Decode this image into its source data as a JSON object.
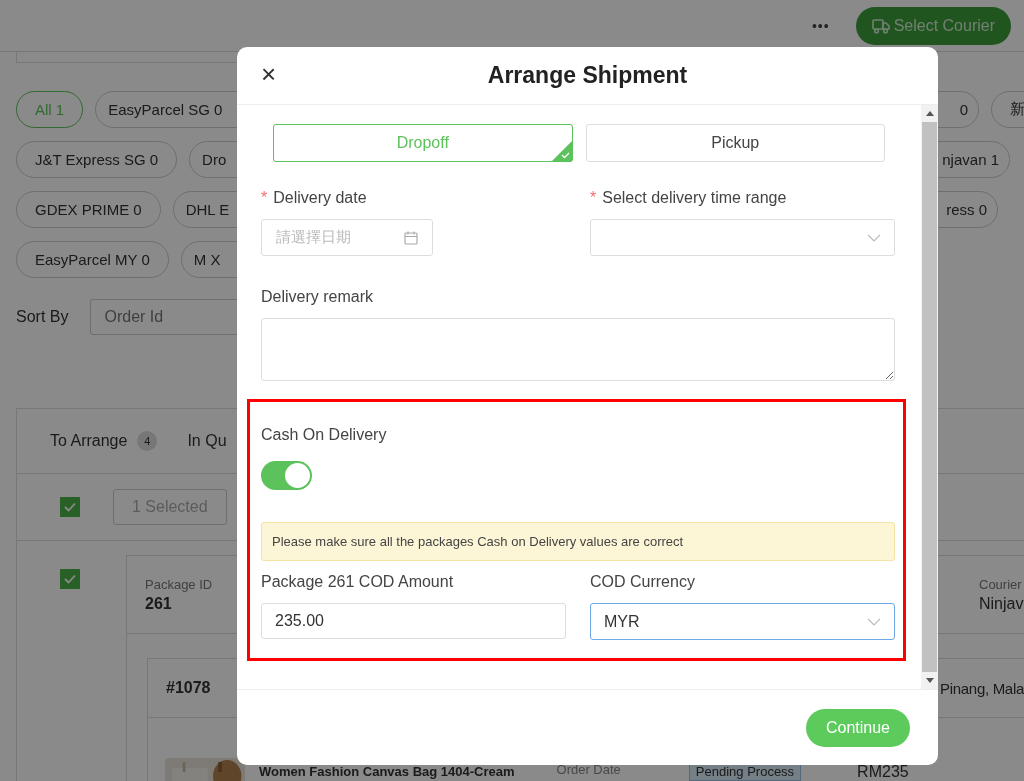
{
  "top_bar": {
    "more": "•••",
    "select_courier": "Select Courier"
  },
  "courier_filters": [
    {
      "left": [
        {
          "label": "All 1",
          "selected": true
        },
        {
          "label": "EasyParcel SG 0",
          "selected": false
        }
      ],
      "right": [
        {
          "label": "0",
          "selected": false
        },
        {
          "label": "新",
          "selected": false
        }
      ]
    },
    {
      "left": [
        {
          "label": "J&T Express SG 0",
          "selected": false
        },
        {
          "label": "Dro",
          "selected": false
        }
      ],
      "right": [
        {
          "label": "njavan 1",
          "selected": false
        }
      ]
    },
    {
      "left": [
        {
          "label": "GDEX PRIME 0",
          "selected": false
        },
        {
          "label": "DHL E",
          "selected": false
        }
      ],
      "right": [
        {
          "label": "ress 0",
          "selected": false
        }
      ]
    },
    {
      "left": [
        {
          "label": "EasyParcel MY 0",
          "selected": false
        },
        {
          "label": "M X",
          "selected": false
        }
      ]
    }
  ],
  "sort": {
    "label": "Sort By",
    "placeholder": "Order Id"
  },
  "list_tabs": [
    {
      "label": "To Arrange",
      "count": "4"
    },
    {
      "label": "In Qu"
    }
  ],
  "bulk": {
    "checked": true,
    "selected_label": "1 Selected"
  },
  "package": {
    "checked": true,
    "id_label": "Package ID",
    "id": "261",
    "courier_label": "Courier",
    "courier": "Ninjav",
    "order": "#1078",
    "address": "Pinang, Mala",
    "product": "Women Fashion Canvas Bag 1404-Cream",
    "order_date_label": "Order Date",
    "status": "Pending Process",
    "amount": "RM235"
  },
  "dialog": {
    "title": "Arrange Shipment",
    "close": "×",
    "methods": [
      {
        "label": "Dropoff",
        "selected": true
      },
      {
        "label": "Pickup",
        "selected": false
      }
    ],
    "delivery_date": {
      "required_mark": "*",
      "label": "Delivery date",
      "placeholder": "請選擇日期"
    },
    "time_range": {
      "required_mark": "*",
      "label": "Select delivery time range"
    },
    "remark": {
      "label": "Delivery remark"
    },
    "cod": {
      "label": "Cash On Delivery",
      "on": true,
      "notice": "Please make sure all the packages Cash on Delivery values are correct",
      "amount_label": "Package 261 COD Amount",
      "amount": "235.00",
      "currency_label": "COD Currency",
      "currency": "MYR"
    },
    "continue": "Continue"
  }
}
